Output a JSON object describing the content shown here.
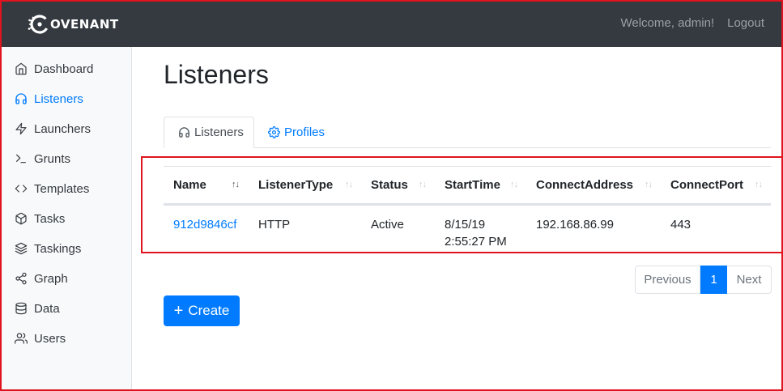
{
  "brand": {
    "text": "OVENANT"
  },
  "topnav": {
    "welcome": "Welcome, admin!",
    "logout": "Logout"
  },
  "sidebar": {
    "items": [
      {
        "label": "Dashboard",
        "icon": "home-icon",
        "active": false
      },
      {
        "label": "Listeners",
        "icon": "headphones-icon",
        "active": true
      },
      {
        "label": "Launchers",
        "icon": "zap-icon",
        "active": false
      },
      {
        "label": "Grunts",
        "icon": "terminal-icon",
        "active": false
      },
      {
        "label": "Templates",
        "icon": "code-icon",
        "active": false
      },
      {
        "label": "Tasks",
        "icon": "box-icon",
        "active": false
      },
      {
        "label": "Taskings",
        "icon": "layers-icon",
        "active": false
      },
      {
        "label": "Graph",
        "icon": "share-icon",
        "active": false
      },
      {
        "label": "Data",
        "icon": "database-icon",
        "active": false
      },
      {
        "label": "Users",
        "icon": "users-icon",
        "active": false
      }
    ]
  },
  "page": {
    "title": "Listeners"
  },
  "tabs": {
    "listeners": "Listeners",
    "profiles": "Profiles"
  },
  "table": {
    "headers": [
      "Name",
      "ListenerType",
      "Status",
      "StartTime",
      "ConnectAddress",
      "ConnectPort"
    ],
    "rows": [
      {
        "name": "912d9846cf",
        "type": "HTTP",
        "status": "Active",
        "start_date": "8/15/19",
        "start_time": "2:55:27 PM",
        "address": "192.168.86.99",
        "port": "443"
      }
    ]
  },
  "pagination": {
    "previous": "Previous",
    "current": "1",
    "next": "Next"
  },
  "actions": {
    "create_plus": "+",
    "create": "Create"
  },
  "colors": {
    "accent": "#007bff",
    "topbar": "#343a40",
    "highlight": "#e0141e"
  }
}
